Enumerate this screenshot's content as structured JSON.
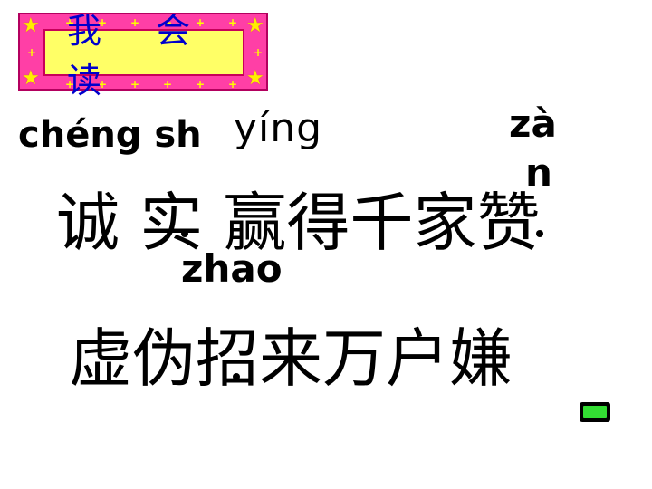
{
  "banner": {
    "title": "我 会 读"
  },
  "pinyin": {
    "cheng_shi": "chéng sh",
    "ying": "yíng",
    "zan_1": "zà",
    "zan_2": "n",
    "zhao": "zhao"
  },
  "lines": {
    "line1": "诚 实  赢得千家赞",
    "line2": "虚伪招来万户嫌"
  },
  "colors": {
    "banner_frame": "#ff3fa6",
    "banner_fill": "#ffff66",
    "banner_text": "#0000cc",
    "button_fill": "#33dd33"
  }
}
